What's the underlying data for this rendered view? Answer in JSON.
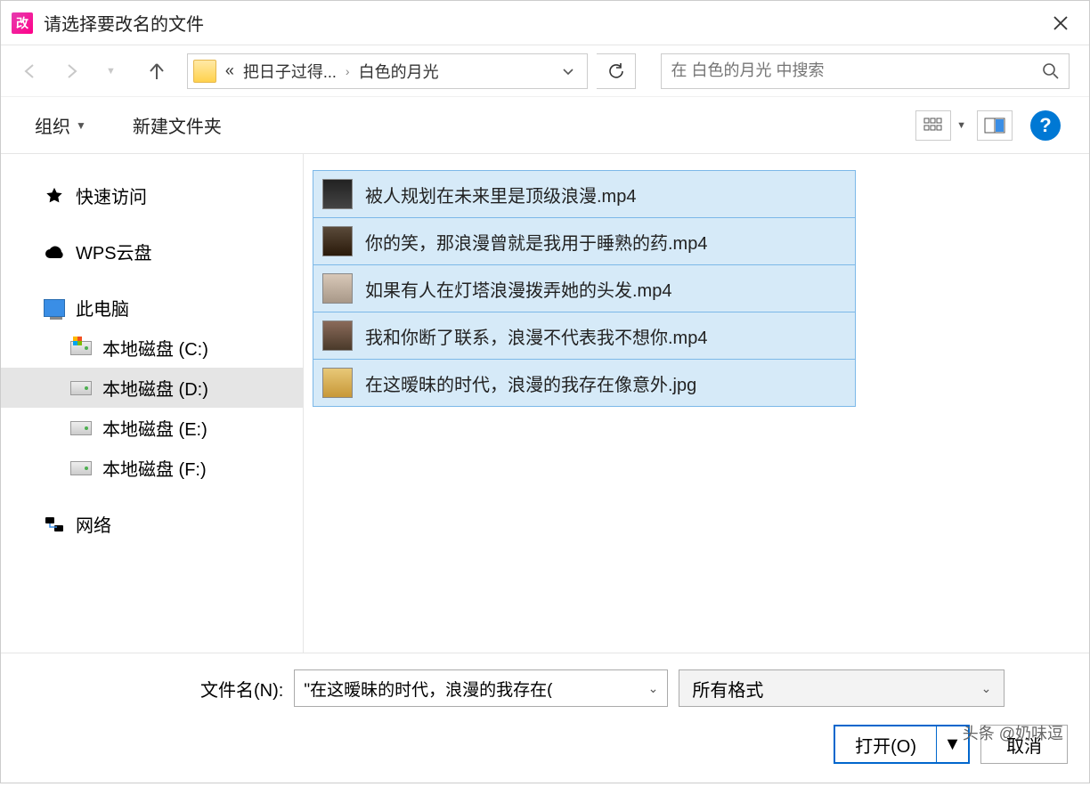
{
  "titlebar": {
    "app_icon_text": "改",
    "title": "请选择要改名的文件"
  },
  "nav": {
    "breadcrumb_prefix": "«",
    "breadcrumb_1": "把日子过得...",
    "breadcrumb_2": "白色的月光",
    "search_placeholder": "在 白色的月光 中搜索"
  },
  "toolbar": {
    "organize": "组织",
    "new_folder": "新建文件夹"
  },
  "sidebar": {
    "quick_access": "快速访问",
    "wps_cloud": "WPS云盘",
    "this_pc": "此电脑",
    "drive_c": "本地磁盘 (C:)",
    "drive_d": "本地磁盘 (D:)",
    "drive_e": "本地磁盘 (E:)",
    "drive_f": "本地磁盘 (F:)",
    "network": "网络"
  },
  "files": [
    {
      "name": "被人规划在未来里是顶级浪漫.mp4"
    },
    {
      "name": "你的笑，那浪漫曾就是我用于睡熟的药.mp4"
    },
    {
      "name": "如果有人在灯塔浪漫拨弄她的头发.mp4"
    },
    {
      "name": "我和你断了联系，浪漫不代表我不想你.mp4"
    },
    {
      "name": "在这暧昧的时代，浪漫的我存在像意外.jpg"
    }
  ],
  "footer": {
    "filename_label": "文件名(N):",
    "filename_value": "\"在这暧昧的时代，浪漫的我存在(",
    "filter_label": "所有格式",
    "open_label": "打开(O)",
    "cancel_label": "取消"
  },
  "watermark": "头条 @奶味逗"
}
